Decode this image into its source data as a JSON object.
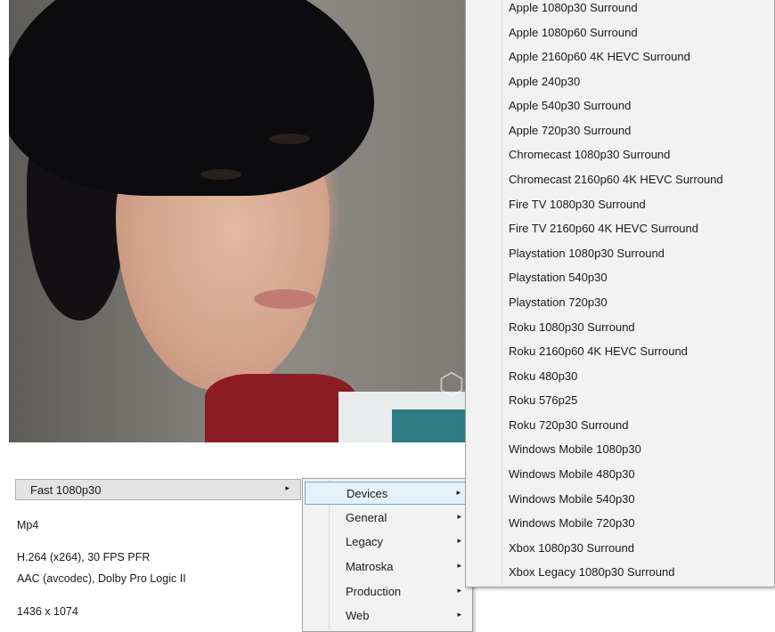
{
  "preset": {
    "selected": "Fast 1080p30",
    "arrow": "▸"
  },
  "summary": {
    "container": "Mp4",
    "video": "H.264 (x264), 30 FPS PFR",
    "audio": "AAC (avcodec), Dolby Pro Logic II",
    "resolution": "1436 x 1074"
  },
  "categories": [
    {
      "label": "Devices"
    },
    {
      "label": "General"
    },
    {
      "label": "Legacy"
    },
    {
      "label": "Matroska"
    },
    {
      "label": "Production"
    },
    {
      "label": "Web"
    }
  ],
  "submenu_arrow": "▸",
  "devices": [
    "Apple 1080p30 Surround",
    "Apple 1080p60 Surround",
    "Apple 2160p60 4K HEVC Surround",
    "Apple 240p30",
    "Apple 540p30 Surround",
    "Apple 720p30 Surround",
    "Chromecast 1080p30 Surround",
    "Chromecast 2160p60 4K HEVC Surround",
    "Fire TV 1080p30 Surround",
    "Fire TV 2160p60 4K HEVC Surround",
    "Playstation 1080p30 Surround",
    "Playstation 540p30",
    "Playstation 720p30",
    "Roku 1080p30 Surround",
    "Roku 2160p60 4K HEVC Surround",
    "Roku 480p30",
    "Roku 576p25",
    "Roku 720p30 Surround",
    "Windows Mobile 1080p30",
    "Windows Mobile 480p30",
    "Windows Mobile 540p30",
    "Windows Mobile 720p30",
    "Xbox 1080p30 Surround",
    "Xbox Legacy 1080p30 Surround"
  ]
}
